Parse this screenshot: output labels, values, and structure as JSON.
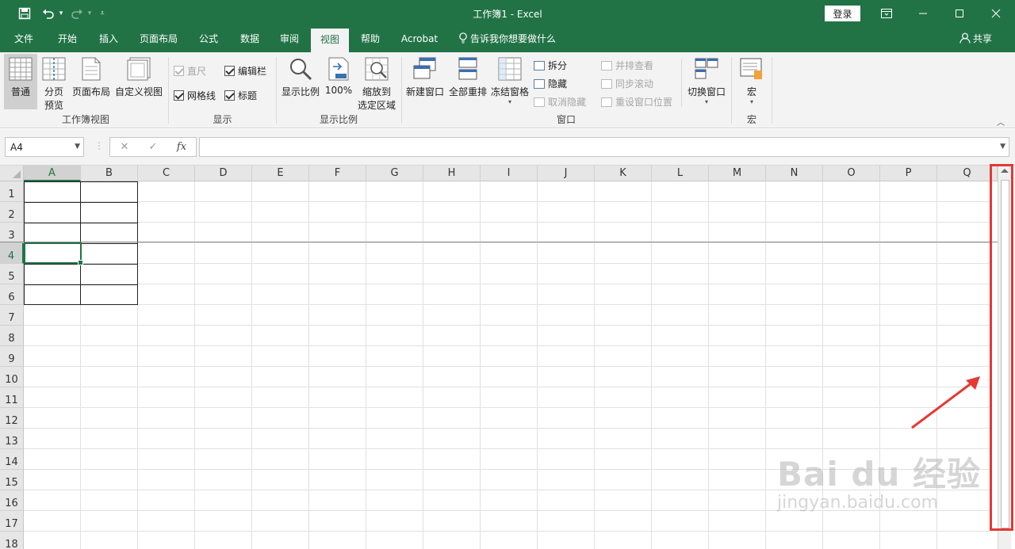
{
  "titlebar": {
    "title": "工作簿1  -  Excel",
    "login_label": "登录",
    "icons": [
      "save-icon",
      "undo-icon",
      "redo-icon",
      "customize-qat-icon",
      "ribbon-display-icon",
      "minimize-icon",
      "maximize-icon",
      "close-icon"
    ]
  },
  "tabs": {
    "items": [
      "文件",
      "开始",
      "插入",
      "页面布局",
      "公式",
      "数据",
      "审阅",
      "视图",
      "帮助",
      "Acrobat"
    ],
    "active": "视图",
    "tellme": "告诉我你想要做什么",
    "share": "共享"
  },
  "ribbon": {
    "workbook_views": {
      "label": "工作簿视图",
      "normal": "普通",
      "page_break_line1": "分页",
      "page_break_line2": "预览",
      "page_layout": "页面布局",
      "custom_views": "自定义视图"
    },
    "show": {
      "label": "显示",
      "ruler": "直尺",
      "formula_bar": "编辑栏",
      "gridlines": "网格线",
      "headings": "标题"
    },
    "zoom": {
      "label": "显示比例",
      "zoom": "显示比例",
      "zoom_100": "100%",
      "zoom_selection_line1": "缩放到",
      "zoom_selection_line2": "选定区域"
    },
    "window": {
      "label": "窗口",
      "new_window": "新建窗口",
      "arrange_all": "全部重排",
      "freeze_panes": "冻结窗格",
      "split": "拆分",
      "hide": "隐藏",
      "unhide": "取消隐藏",
      "view_side_by_side": "并排查看",
      "sync_scrolling": "同步滚动",
      "reset_position": "重设窗口位置",
      "switch_windows": "切换窗口"
    },
    "macros": {
      "label": "宏",
      "macros": "宏"
    }
  },
  "formula_bar": {
    "name_box": "A4",
    "cancel": "✕",
    "enter": "✓",
    "fx": "fx",
    "value": ""
  },
  "sheet": {
    "columns": [
      "A",
      "B",
      "C",
      "D",
      "E",
      "F",
      "G",
      "H",
      "I",
      "J",
      "K",
      "L",
      "M",
      "N",
      "O",
      "P",
      "Q"
    ],
    "rows": [
      "1",
      "2",
      "3",
      "4",
      "5",
      "6",
      "7",
      "8",
      "9",
      "10",
      "11",
      "12",
      "13",
      "14",
      "15",
      "16",
      "17",
      "18"
    ],
    "selected_cell": "A4"
  },
  "watermark": {
    "brand": "Bai du 经验",
    "url": "jingyan.baidu.com"
  },
  "colors": {
    "excel_green": "#217346",
    "highlight_red": "#e53935"
  }
}
